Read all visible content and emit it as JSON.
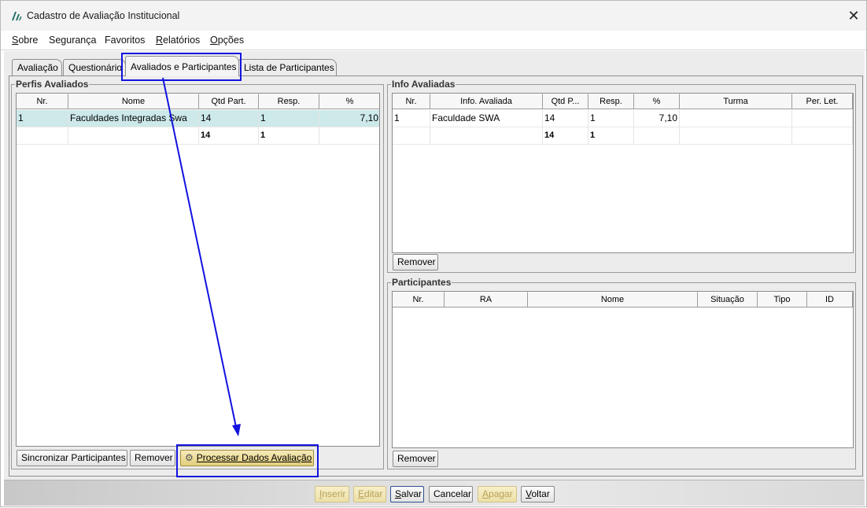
{
  "window": {
    "title": "Cadastro de Avaliação Institucional",
    "close_glyph": "✕",
    "app_icon": "app-logo-icon"
  },
  "menu": [
    {
      "label": "Sobre",
      "mnemonic": "S",
      "rest": "obre"
    },
    {
      "label": "Segurança",
      "mnemonic": "",
      "rest": "Segurança"
    },
    {
      "label": "Favoritos",
      "mnemonic": "",
      "rest": "Favoritos"
    },
    {
      "label": "Relatórios",
      "mnemonic": "R",
      "rest": "elatórios"
    },
    {
      "label": "Opções",
      "mnemonic": "O",
      "rest": "pções"
    }
  ],
  "tabs": [
    {
      "label": "Avaliação"
    },
    {
      "label": "Questionário"
    },
    {
      "label": "Avaliados e Participantes",
      "active": true
    },
    {
      "label": "Lista de Participantes"
    }
  ],
  "perfis": {
    "title": "Perfis Avaliados",
    "columns": [
      "Nr.",
      "Nome",
      "Qtd Part.",
      "Resp.",
      "%"
    ],
    "rows": [
      {
        "nr": "1",
        "nome": "Faculdades Integradas Swa",
        "qtd": "14",
        "resp": "1",
        "pct": "7,10"
      }
    ],
    "totals": {
      "qtd": "14",
      "resp": "1"
    },
    "buttons": {
      "sincronizar": "Sincronizar Participantes",
      "remover": "Remover",
      "processar": "Processar Dados Avaliação"
    }
  },
  "info": {
    "title": "Info Avaliadas",
    "columns": [
      "Nr.",
      "Info. Avaliada",
      "Qtd P...",
      "Resp.",
      "%",
      "Turma",
      "Per. Let."
    ],
    "rows": [
      {
        "nr": "1",
        "info": "Faculdade SWA",
        "qtd": "14",
        "resp": "1",
        "pct": "7,10",
        "turma": "",
        "per": ""
      }
    ],
    "totals": {
      "qtd": "14",
      "resp": "1"
    },
    "remover": "Remover"
  },
  "participantes": {
    "title": "Participantes",
    "columns": [
      "Nr.",
      "RA",
      "Nome",
      "Situação",
      "Tipo",
      "ID"
    ],
    "remover": "Remover"
  },
  "footer_buttons": [
    {
      "label": "Inserir",
      "u": "I",
      "rest": "nserir",
      "disabled": true
    },
    {
      "label": "Editar",
      "u": "E",
      "rest": "ditar",
      "disabled": true
    },
    {
      "label": "Salvar",
      "u": "S",
      "rest": "alvar",
      "disabled": false
    },
    {
      "label": "Cancelar",
      "u": "",
      "rest": "Cancelar",
      "disabled": false
    },
    {
      "label": "Apagar",
      "u": "A",
      "rest": "pagar",
      "disabled": true
    },
    {
      "label": "Voltar",
      "u": "V",
      "rest": "oltar",
      "disabled": false
    }
  ],
  "annotation": {
    "color": "#1212e0"
  }
}
